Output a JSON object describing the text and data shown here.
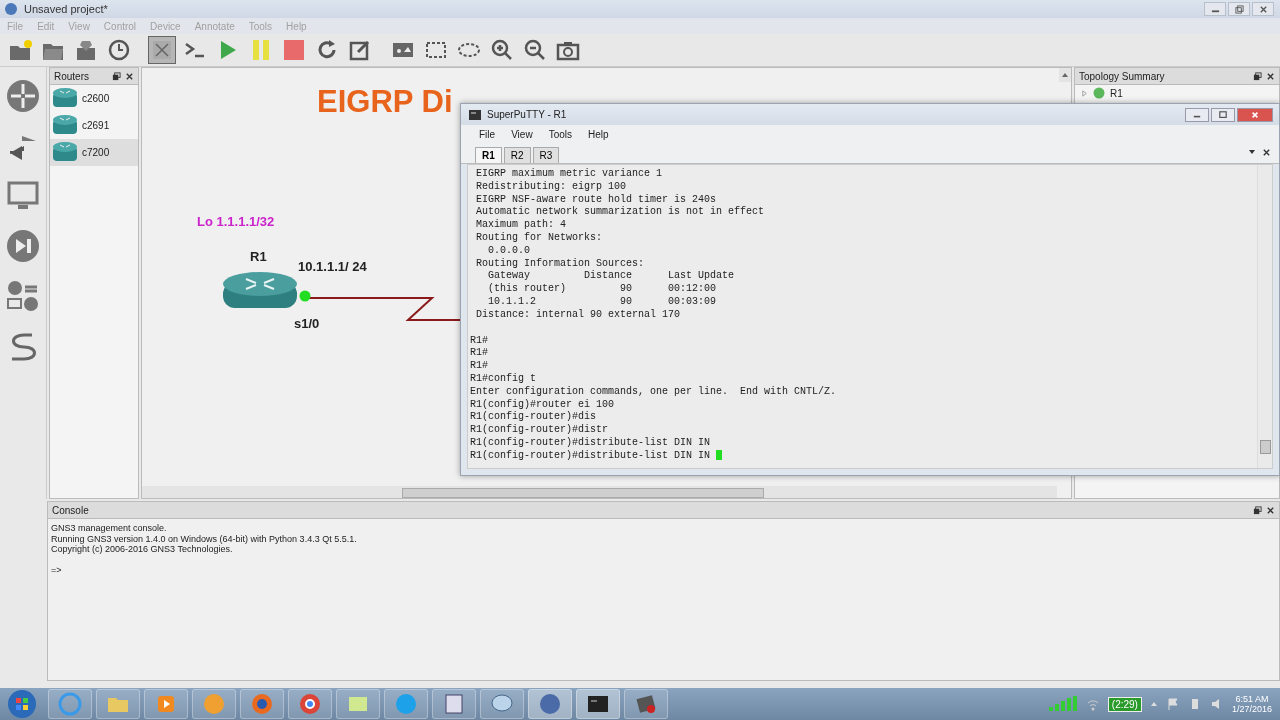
{
  "window": {
    "title": "Unsaved project*"
  },
  "menu": [
    "File",
    "Edit",
    "View",
    "Control",
    "Device",
    "Annotate",
    "Tools",
    "Help"
  ],
  "toolbar_buttons": [
    {
      "selected": false
    },
    {
      "selected": false
    },
    {
      "selected": false
    },
    {
      "selected": false
    },
    {
      "selected": true
    },
    {
      "selected": false
    },
    {
      "selected": false
    },
    {
      "selected": false
    },
    {
      "selected": false
    },
    {
      "selected": false
    },
    {
      "selected": false
    },
    {
      "selected": false
    },
    {
      "selected": false
    },
    {
      "selected": false
    },
    {
      "selected": false
    },
    {
      "selected": false
    },
    {
      "selected": false
    }
  ],
  "routers_panel": {
    "title": "Routers",
    "items": [
      {
        "label": "c2600",
        "selected": false
      },
      {
        "label": "c2691",
        "selected": false
      },
      {
        "label": "c7200",
        "selected": true
      }
    ]
  },
  "canvas": {
    "title": "EIGRP Di",
    "loopback": "Lo 1.1.1.1/32",
    "router": "R1",
    "address": "10.1.1.1/ 24",
    "interface": "s1/0"
  },
  "terminal": {
    "title": "SuperPuTTY - R1",
    "menu": [
      "File",
      "View",
      "Tools",
      "Help"
    ],
    "tabs": [
      {
        "label": "R1",
        "selected": true
      },
      {
        "label": "R2",
        "selected": false
      },
      {
        "label": "R3",
        "selected": false
      }
    ],
    "output": [
      " EIGRP maximum metric variance 1",
      " Redistributing: eigrp 100",
      " EIGRP NSF-aware route hold timer is 240s",
      " Automatic network summarization is not in effect",
      " Maximum path: 4",
      " Routing for Networks:",
      "   0.0.0.0",
      " Routing Information Sources:",
      "   Gateway         Distance      Last Update",
      "   (this router)         90      00:12:00",
      "   10.1.1.2              90      00:03:09",
      " Distance: internal 90 external 170"
    ],
    "session": [
      "R1#",
      "R1#",
      "R1#",
      "R1#config t",
      "Enter configuration commands, one per line.  End with CNTL/Z.",
      "R1(config)#router ei 100",
      "R1(config-router)#dis",
      "R1(config-router)#distr",
      "R1(config-router)#distribute-list DIN IN",
      "R1(config-router)#distribute-list DIN IN "
    ]
  },
  "topology_summary": {
    "title": "Topology Summary",
    "items": [
      {
        "label": "R1"
      }
    ]
  },
  "console": {
    "title": "Console",
    "lines": [
      "GNS3 management console.",
      "Running GNS3 version 1.4.0 on Windows (64-bit) with Python 3.4.3 Qt 5.5.1.",
      "Copyright (c) 2006-2016 GNS3 Technologies."
    ],
    "prompt": "=>"
  },
  "taskbar": {
    "battery": "(2:29)",
    "time": "6:51 AM",
    "date": "1/27/2016"
  }
}
